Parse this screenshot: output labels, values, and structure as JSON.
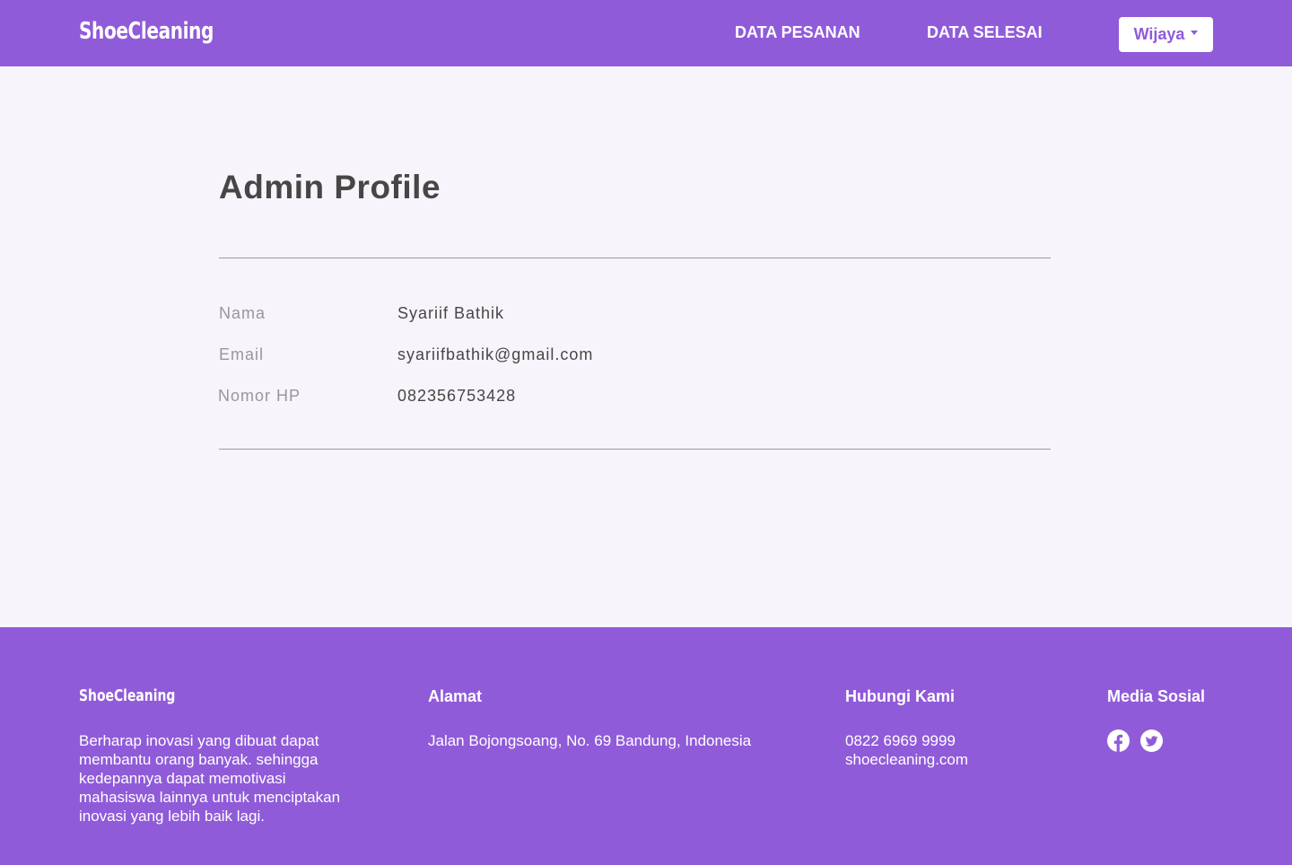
{
  "navbar": {
    "brand": "ShoeCleaning",
    "links": [
      {
        "label": "DATA PESANAN"
      },
      {
        "label": "DATA SELESAI"
      }
    ],
    "user_menu": {
      "label": "Wijaya"
    }
  },
  "profile": {
    "title": "Admin Profile",
    "fields": [
      {
        "label": "Nama",
        "value": "Syariif Bathik"
      },
      {
        "label": "Email",
        "value": "syariifbathik@gmail.com"
      },
      {
        "label": "Nomor HP",
        "value": "082356753428"
      }
    ]
  },
  "footer": {
    "brand": "ShoeCleaning",
    "description": "Berharap inovasi yang dibuat dapat membantu orang banyak. sehingga kedepannya dapat memotivasi mahasiswa lainnya untuk menciptakan inovasi yang lebih baik lagi.",
    "address": {
      "heading": "Alamat",
      "text": "Jalan Bojongsoang, No. 69 Bandung, Indonesia"
    },
    "contact": {
      "heading": "Hubungi Kami",
      "phone": "0822 6969 9999",
      "website": "shoecleaning.com"
    },
    "social": {
      "heading": "Media Sosial",
      "icons": [
        "facebook-icon",
        "twitter-icon"
      ]
    }
  },
  "colors": {
    "primary": "#905BD9",
    "background": "#F7F4FC",
    "text_dark": "#4A4545",
    "text_muted": "#9A9797"
  }
}
